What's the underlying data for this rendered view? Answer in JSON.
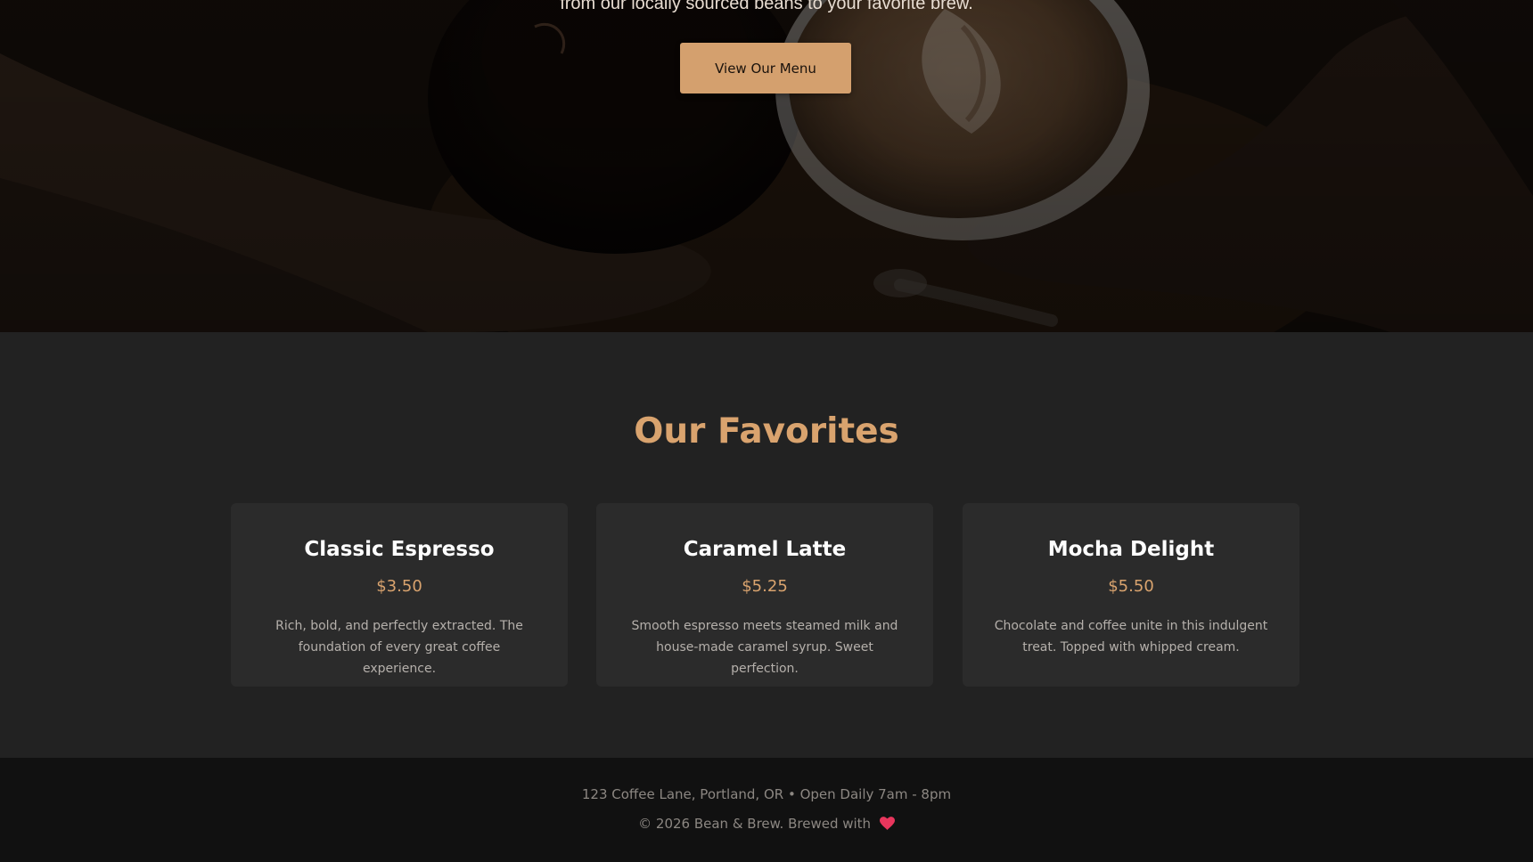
{
  "hero": {
    "tagline": "from our locally sourced beans to your favorite brew.",
    "cta_label": "View Our Menu"
  },
  "favorites": {
    "title": "Our Favorites",
    "items": [
      {
        "name": "Classic Espresso",
        "price": "$3.50",
        "description": "Rich, bold, and perfectly extracted. The foundation of every great coffee experience."
      },
      {
        "name": "Caramel Latte",
        "price": "$5.25",
        "description": "Smooth espresso meets steamed milk and house-made caramel syrup. Sweet perfection."
      },
      {
        "name": "Mocha Delight",
        "price": "$5.50",
        "description": "Chocolate and coffee unite in this indulgent treat. Topped with whipped cream."
      }
    ]
  },
  "footer": {
    "address_hours": "123 Coffee Lane, Portland, OR • Open Daily 7am - 8pm",
    "copyright": "© 2026 Bean & Brew. Brewed with",
    "heart_icon": "heart-icon"
  },
  "colors": {
    "accent": "#d4a06e",
    "title_accent": "#d9a36e",
    "heart": "#e8365d",
    "section_bg": "#222222",
    "card_bg": "#2b2b2b",
    "footer_bg": "#111111"
  }
}
